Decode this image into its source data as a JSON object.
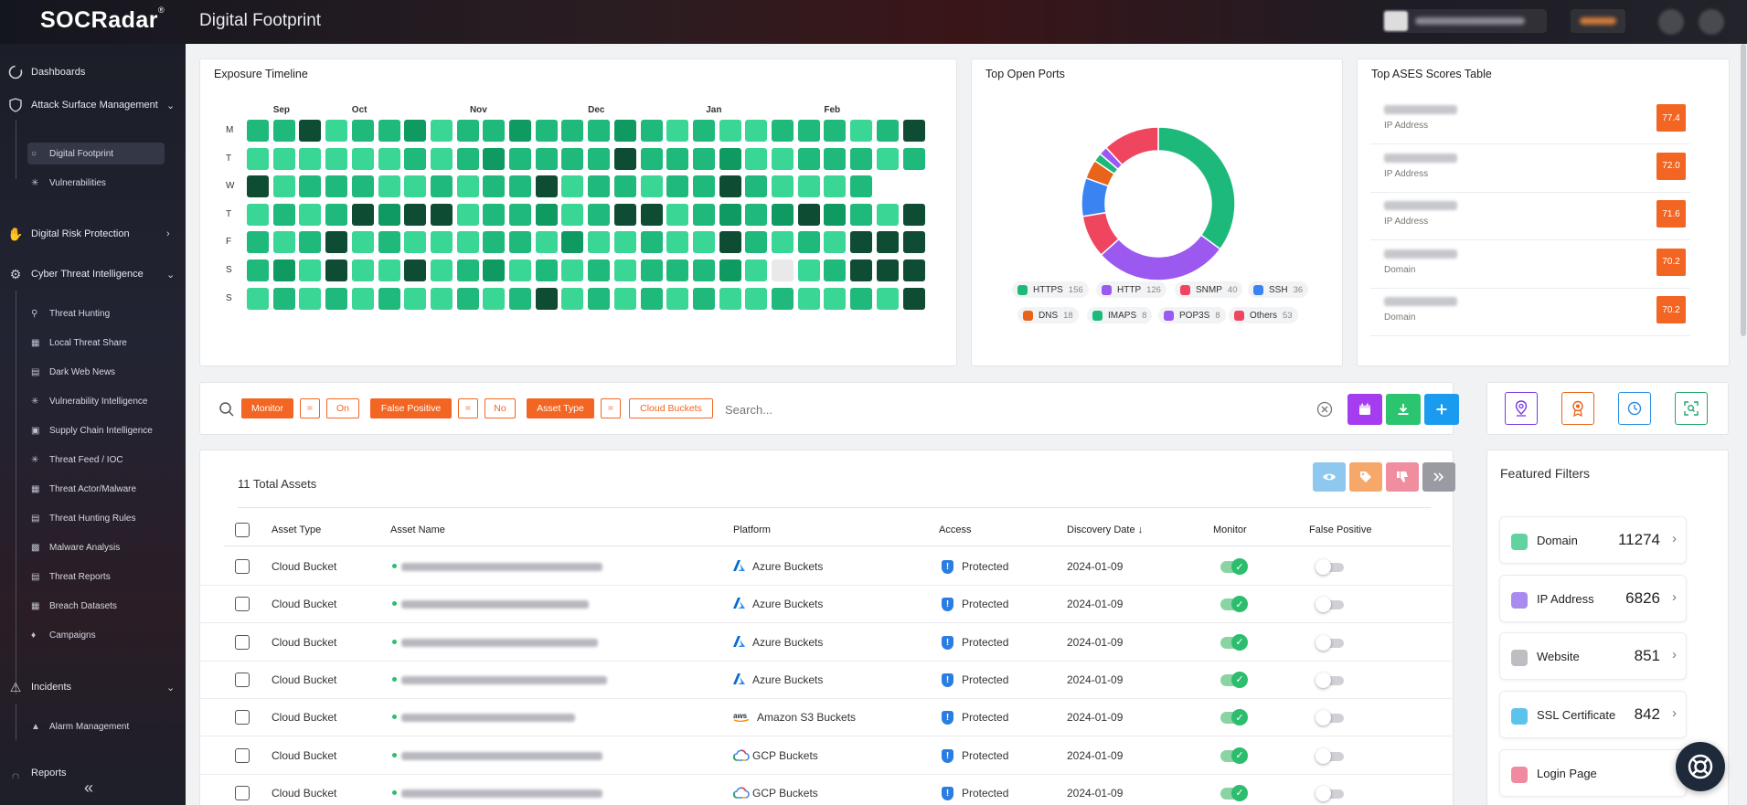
{
  "app": {
    "logo": "SOCRadar",
    "logo_mark": "®",
    "page_title": "Digital Footprint"
  },
  "sidebar": {
    "sections": [
      {
        "label": "Dashboards",
        "icon": "dashboard-icon"
      },
      {
        "label": "Attack Surface Management",
        "icon": "shield-icon",
        "expanded": true
      },
      {
        "label": "Digital Risk Protection",
        "icon": "hand-icon",
        "expanded": false
      },
      {
        "label": "Cyber Threat Intelligence",
        "icon": "gear-icon",
        "expanded": true
      },
      {
        "label": "Incidents",
        "icon": "alarm-icon",
        "expanded": true
      },
      {
        "label": "Reports",
        "icon": "report-icon"
      }
    ],
    "asm_items": [
      "Digital Footprint",
      "Vulnerabilities"
    ],
    "cti_items": [
      "Threat Hunting",
      "Local Threat Share",
      "Dark Web News",
      "Vulnerability Intelligence",
      "Supply Chain Intelligence",
      "Threat Feed / IOC",
      "Threat Actor/Malware",
      "Threat Hunting Rules",
      "Malware Analysis",
      "Threat Reports",
      "Breach Datasets",
      "Campaigns"
    ],
    "incident_items": [
      "Alarm Management"
    ],
    "collapse_icon": "double-chevron-left-icon"
  },
  "exposure_timeline": {
    "title": "Exposure Timeline",
    "months": [
      "Sep",
      "Oct",
      "Nov",
      "Dec",
      "Jan",
      "Feb"
    ],
    "days": [
      "M",
      "T",
      "W",
      "T",
      "F",
      "S",
      "S"
    ],
    "palette": [
      "#3ad696",
      "#1fb97b",
      "#0f9a61",
      "#0e4d33",
      "#e9e9ea"
    ],
    "grid": [
      [
        1,
        1,
        3,
        0,
        1,
        1,
        2,
        0,
        1,
        1,
        2,
        1,
        1,
        1,
        2,
        1,
        0,
        1,
        0,
        0,
        1,
        1,
        1,
        0,
        1,
        3
      ],
      [
        0,
        0,
        0,
        0,
        0,
        0,
        1,
        0,
        1,
        2,
        1,
        1,
        1,
        1,
        3,
        1,
        1,
        1,
        2,
        0,
        0,
        1,
        1,
        1,
        0,
        1
      ],
      [
        3,
        0,
        1,
        1,
        1,
        0,
        0,
        1,
        0,
        1,
        1,
        3,
        0,
        1,
        1,
        0,
        1,
        1,
        3,
        1,
        0,
        0,
        0,
        1
      ],
      [
        0,
        1,
        0,
        1,
        3,
        2,
        3,
        3,
        0,
        1,
        1,
        2,
        0,
        1,
        3,
        3,
        0,
        1,
        2,
        1,
        2,
        3,
        2,
        1,
        0,
        3
      ],
      [
        1,
        0,
        1,
        3,
        0,
        1,
        0,
        0,
        0,
        1,
        1,
        0,
        2,
        0,
        0,
        1,
        0,
        0,
        3,
        1,
        0,
        1,
        0,
        3,
        3,
        3
      ],
      [
        1,
        2,
        0,
        3,
        0,
        0,
        3,
        0,
        1,
        2,
        0,
        1,
        0,
        1,
        0,
        1,
        1,
        1,
        2,
        0,
        4,
        0,
        1,
        3,
        3,
        3
      ],
      [
        0,
        1,
        0,
        1,
        0,
        1,
        0,
        0,
        1,
        0,
        1,
        3,
        0,
        1,
        0,
        1,
        0,
        1,
        0,
        0,
        1,
        0,
        0,
        1,
        0,
        3
      ]
    ]
  },
  "top_open_ports": {
    "title": "Top Open Ports",
    "chart_data": {
      "type": "pie",
      "categories": [
        "HTTPS",
        "HTTP",
        "SNMP",
        "SSH",
        "DNS",
        "IMAPS",
        "POP3S",
        "Others"
      ],
      "values": [
        156,
        126,
        40,
        36,
        18,
        8,
        8,
        53
      ],
      "colors": [
        "#1db97b",
        "#9b59f0",
        "#f0455e",
        "#3a84f2",
        "#e8641b",
        "#1db97b",
        "#9b59f0",
        "#f0455e"
      ]
    },
    "legend": [
      {
        "label": "HTTPS",
        "count": "156",
        "color": "#1db97b"
      },
      {
        "label": "HTTP",
        "count": "126",
        "color": "#9b59f0"
      },
      {
        "label": "SNMP",
        "count": "40",
        "color": "#f0455e"
      },
      {
        "label": "SSH",
        "count": "36",
        "color": "#3a84f2"
      },
      {
        "label": "DNS",
        "count": "18",
        "color": "#e8641b"
      },
      {
        "label": "IMAPS",
        "count": "8",
        "color": "#1db97b"
      },
      {
        "label": "POP3S",
        "count": "8",
        "color": "#9b59f0"
      },
      {
        "label": "Others",
        "count": "53",
        "color": "#f0455e"
      }
    ]
  },
  "ases_table": {
    "title": "Top ASES Scores Table",
    "rows": [
      {
        "type": "IP Address",
        "score": "77.4"
      },
      {
        "type": "IP Address",
        "score": "72.0"
      },
      {
        "type": "IP Address",
        "score": "71.6"
      },
      {
        "type": "Domain",
        "score": "70.2"
      },
      {
        "type": "Domain",
        "score": "70.2"
      }
    ]
  },
  "filters": {
    "chips": [
      {
        "key": "Monitor",
        "op": "=",
        "value": "On"
      },
      {
        "key": "False Positive",
        "op": "=",
        "value": "No"
      },
      {
        "key": "Asset Type",
        "op": "=",
        "value": "Cloud Buckets"
      }
    ],
    "search_placeholder": "Search...",
    "clear_icon": "clear-circle-icon"
  },
  "toolbar": {
    "buttons": [
      {
        "name": "calendar-button",
        "icon": "calendar-icon",
        "color": "#a63cf0"
      },
      {
        "name": "download-button",
        "icon": "download-icon",
        "color": "#2cc56f"
      },
      {
        "name": "add-button",
        "icon": "plus-icon",
        "color": "#1b9bf0"
      }
    ],
    "side_buttons": [
      {
        "name": "location-button",
        "icon": "map-pin-icon",
        "color": "#7a3be0"
      },
      {
        "name": "badge-button",
        "icon": "badge-icon",
        "color": "#e8641b"
      },
      {
        "name": "history-button",
        "icon": "history-icon",
        "color": "#2a8de1"
      },
      {
        "name": "scan-button",
        "icon": "scan-icon",
        "color": "#23a66a"
      }
    ]
  },
  "assets": {
    "total_label": "11 Total Assets",
    "bulk_actions": [
      {
        "name": "monitor-action-button",
        "icon": "eye-icon",
        "color": "#8ec8ef"
      },
      {
        "name": "tag-action-button",
        "icon": "tag-icon",
        "color": "#f5a86a"
      },
      {
        "name": "false-positive-action-button",
        "icon": "thumbs-down-icon",
        "color": "#f08ea0"
      },
      {
        "name": "more-action-button",
        "icon": "double-chevron-right-icon",
        "color": "#9a9ba2"
      }
    ],
    "columns": [
      "Asset Type",
      "Asset Name",
      "Platform",
      "Access",
      "Discovery Date",
      "Monitor",
      "False Positive"
    ],
    "sort_indicator": "↓",
    "rows": [
      {
        "type": "Cloud Bucket",
        "platform": "Azure Buckets",
        "platform_icon": "azure-icon",
        "access": "Protected",
        "date": "2024-01-09",
        "monitor": true,
        "false_positive": false
      },
      {
        "type": "Cloud Bucket",
        "platform": "Azure Buckets",
        "platform_icon": "azure-icon",
        "access": "Protected",
        "date": "2024-01-09",
        "monitor": true,
        "false_positive": false
      },
      {
        "type": "Cloud Bucket",
        "platform": "Azure Buckets",
        "platform_icon": "azure-icon",
        "access": "Protected",
        "date": "2024-01-09",
        "monitor": true,
        "false_positive": false
      },
      {
        "type": "Cloud Bucket",
        "platform": "Azure Buckets",
        "platform_icon": "azure-icon",
        "access": "Protected",
        "date": "2024-01-09",
        "monitor": true,
        "false_positive": false
      },
      {
        "type": "Cloud Bucket",
        "platform": "Amazon S3 Buckets",
        "platform_icon": "aws-icon",
        "access": "Protected",
        "date": "2024-01-09",
        "monitor": true,
        "false_positive": false
      },
      {
        "type": "Cloud Bucket",
        "platform": "GCP Buckets",
        "platform_icon": "gcp-icon",
        "access": "Protected",
        "date": "2024-01-09",
        "monitor": true,
        "false_positive": false
      },
      {
        "type": "Cloud Bucket",
        "platform": "GCP Buckets",
        "platform_icon": "gcp-icon",
        "access": "Protected",
        "date": "2024-01-09",
        "monitor": true,
        "false_positive": false
      }
    ]
  },
  "featured_filters": {
    "title": "Featured Filters",
    "items": [
      {
        "label": "Domain",
        "count": "11274",
        "color": "#5fd3a0"
      },
      {
        "label": "IP Address",
        "count": "6826",
        "color": "#a98bf0"
      },
      {
        "label": "Website",
        "count": "851",
        "color": "#bdbec2"
      },
      {
        "label": "SSL Certificate",
        "count": "842",
        "color": "#5cc3ea"
      },
      {
        "label": "Login Page",
        "count": "",
        "color": "#f08aa0"
      }
    ]
  },
  "support_icon": "lifebuoy-icon"
}
